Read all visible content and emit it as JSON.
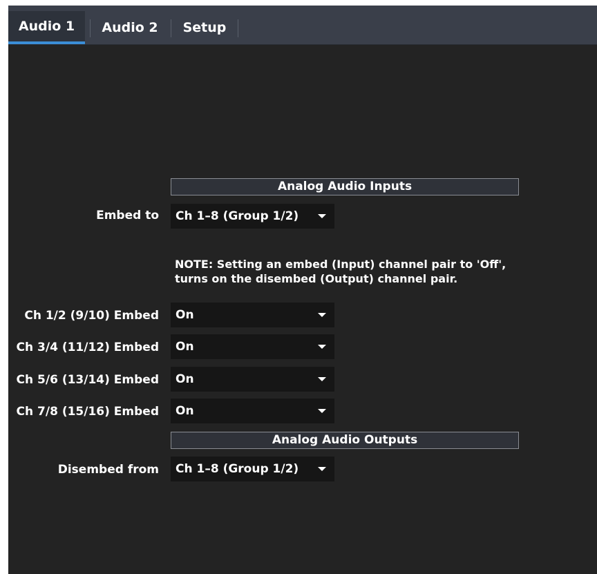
{
  "tabs": [
    {
      "label": "Audio 1",
      "active": true
    },
    {
      "label": "Audio 2",
      "active": false
    },
    {
      "label": "Setup",
      "active": false
    }
  ],
  "inputs_section": {
    "title": "Analog Audio Inputs",
    "embed_to": {
      "label": "Embed to",
      "value": "Ch 1–8  (Group 1/2)"
    },
    "note": "NOTE: Setting an embed (Input) channel pair to 'Off', turns on the disembed (Output) channel pair.",
    "channels": [
      {
        "label": "Ch 1/2 (9/10) Embed",
        "value": "On"
      },
      {
        "label": "Ch 3/4 (11/12) Embed",
        "value": "On"
      },
      {
        "label": "Ch 5/6 (13/14) Embed",
        "value": "On"
      },
      {
        "label": "Ch 7/8 (15/16) Embed",
        "value": "On"
      }
    ]
  },
  "outputs_section": {
    "title": "Analog Audio Outputs",
    "disembed_from": {
      "label": "Disembed from",
      "value": "Ch 1–8  (Group 1/2)"
    }
  },
  "colors": {
    "background": "#232323",
    "tabbar": "#3a3f4a",
    "active_tab_accent": "#3b8ed6",
    "dropdown_bg": "#161616"
  },
  "icons": {
    "dropdown": "caret-down-icon"
  }
}
